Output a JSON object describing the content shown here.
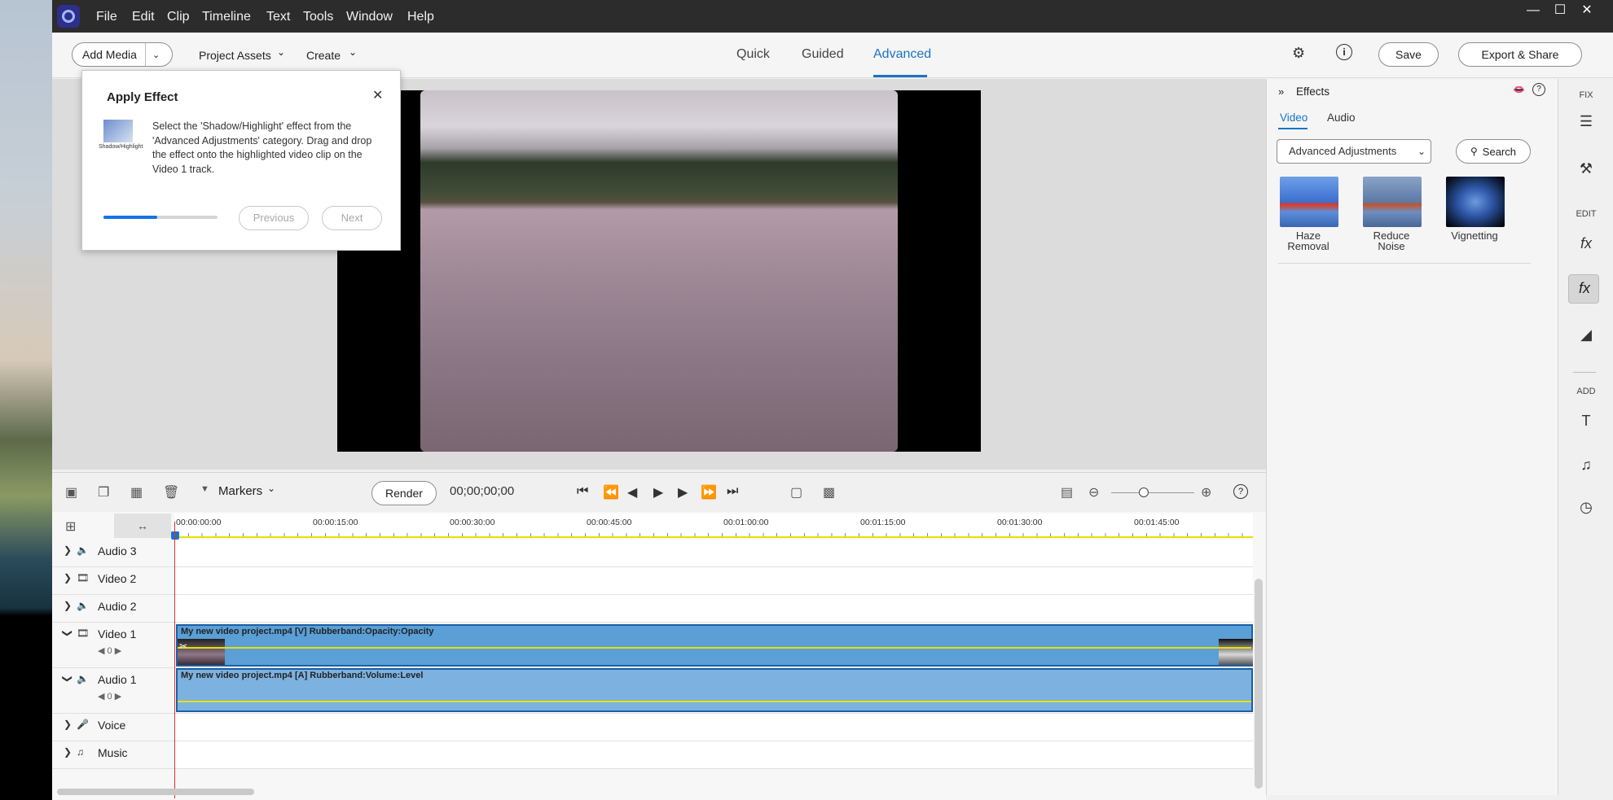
{
  "menu": [
    "File",
    "Edit",
    "Clip",
    "Timeline",
    "Text",
    "Tools",
    "Window",
    "Help"
  ],
  "toolbar": {
    "add_media": "Add Media",
    "project_assets": "Project Assets",
    "create": "Create",
    "modes": [
      "Quick",
      "Guided",
      "Advanced"
    ],
    "active_mode": "Advanced",
    "save": "Save",
    "export": "Export & Share"
  },
  "dialog": {
    "title": "Apply Effect",
    "thumb_label": "Shadow/Highlight",
    "text": "Select the 'Shadow/Highlight' effect from the 'Advanced Adjustments' category. Drag and drop the effect onto the highlighted video clip on the Video 1 track.",
    "progress_fraction": 0.47,
    "previous": "Previous",
    "next": "Next"
  },
  "effects_panel": {
    "title": "Effects",
    "tabs": [
      "Video",
      "Audio"
    ],
    "active_tab": "Video",
    "category": "Advanced Adjustments",
    "search": "Search",
    "items": [
      {
        "label1": "Haze",
        "label2": "Removal"
      },
      {
        "label1": "Reduce",
        "label2": "Noise"
      },
      {
        "label1": "Vignetting",
        "label2": ""
      }
    ]
  },
  "rail": {
    "fix": "FIX",
    "edit": "EDIT",
    "add": "ADD"
  },
  "timeline": {
    "markers": "Markers",
    "render": "Render",
    "timecode": "00;00;00;00",
    "ruler": [
      "00:00:00:00",
      "00:00:15:00",
      "00:00:30:00",
      "00:00:45:00",
      "00:01:00:00",
      "00:01:15:00",
      "00:01:30:00",
      "00:01:45:00"
    ],
    "tracks": [
      {
        "name": "Audio 3",
        "kind": "audio"
      },
      {
        "name": "Video 2",
        "kind": "video"
      },
      {
        "name": "Audio 2",
        "kind": "audio"
      },
      {
        "name": "Video 1",
        "kind": "video",
        "value": "0",
        "clip": "My new video project.mp4 [V]  Rubberband:Opacity:Opacity"
      },
      {
        "name": "Audio 1",
        "kind": "audio",
        "value": "0",
        "clip": "My new video project.mp4 [A]  Rubberband:Volume:Level"
      },
      {
        "name": "Voice",
        "kind": "voice"
      },
      {
        "name": "Music",
        "kind": "music"
      }
    ]
  },
  "colors": {
    "accent": "#1a73c8",
    "clip_fill": "#5a9fd6",
    "rubberband": "#e8e000",
    "playhead": "#e03030"
  }
}
